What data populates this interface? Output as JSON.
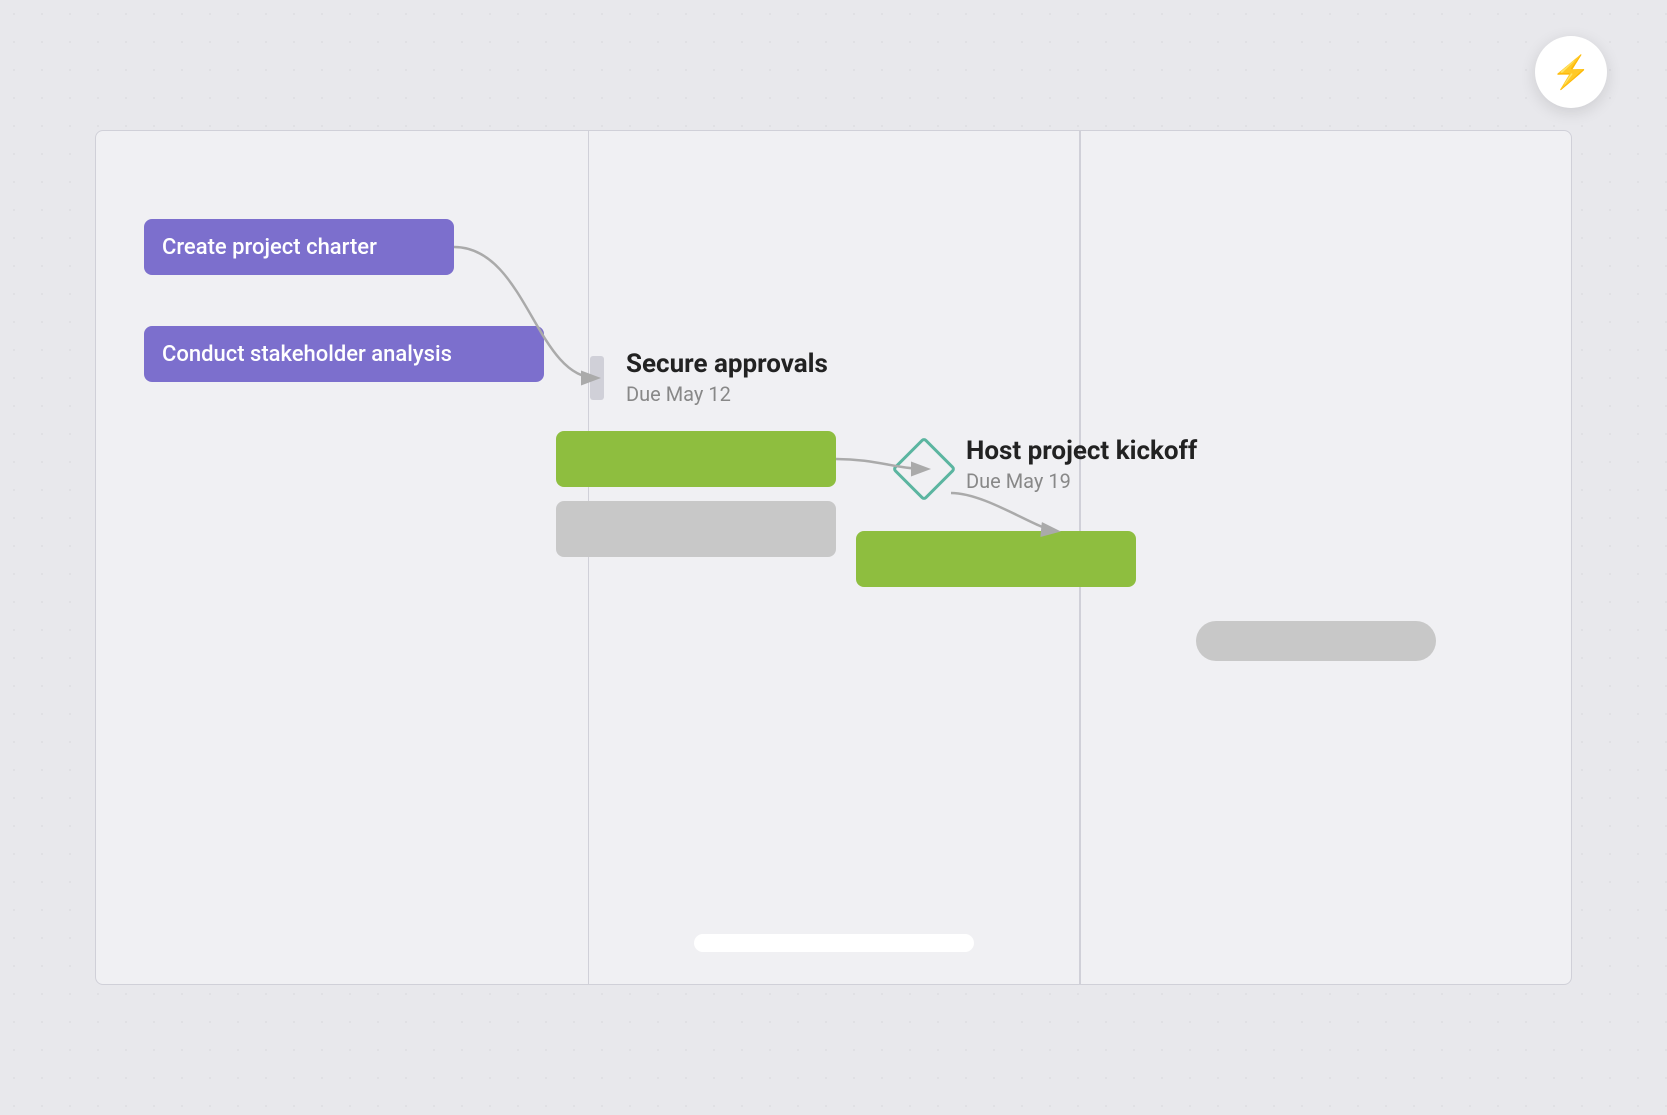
{
  "lightning_button": {
    "aria_label": "Quick actions",
    "icon": "⚡"
  },
  "tasks": {
    "create_project_charter": {
      "label": "Create project charter",
      "color": "#7c6fcd"
    },
    "conduct_stakeholder": {
      "label": "Conduct stakeholder analysis",
      "color": "#7c6fcd"
    },
    "secure_approvals": {
      "title": "Secure approvals",
      "due": "Due May 12"
    },
    "host_kickoff": {
      "title": "Host project kickoff",
      "due": "Due May 19"
    }
  }
}
